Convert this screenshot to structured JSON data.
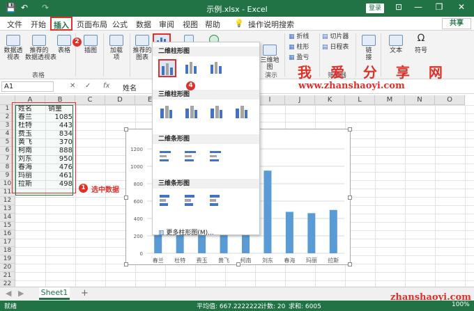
{
  "titlebar": {
    "title": "示例.xlsx  -  Excel",
    "login": "登录",
    "save": "💾",
    "undo": "↶",
    "redo": "↷",
    "minimize": "—",
    "restore": "❐",
    "close": "✕",
    "ribbon_toggle": "⊡"
  },
  "tabs": [
    "文件",
    "开始",
    "插入",
    "页面布局",
    "公式",
    "数据",
    "审阅",
    "视图",
    "帮助"
  ],
  "tell_me": "操作说明搜索",
  "share": "共享",
  "ribbon": {
    "pivot": "数据透\n视表",
    "rec_pivot": "推荐的\n数据透视表",
    "table": "表格",
    "group_table": "表格",
    "illustrations": "插图",
    "addins": "加载\n项",
    "rec_charts": "推荐的\n图表",
    "map3d": "三维地\n图",
    "group_demo": "演示",
    "line": "折线",
    "column": "柱形",
    "winloss": "盈亏",
    "slicer": "切片器",
    "timeline": "日程表",
    "filter_group": "筛选器",
    "link": "链\n接",
    "text": "文本",
    "symbol": "符号"
  },
  "callouts": [
    "1",
    "2",
    "3",
    "4"
  ],
  "watermark": "我 爱 分 享 网",
  "website": "www.zhanshaoyi.com",
  "formula": {
    "namebox": "A1",
    "cancel": "✕",
    "enter": "✓",
    "fx": "fx",
    "value": "姓名"
  },
  "columns": [
    "A",
    "B",
    "C",
    "D",
    "E",
    "F",
    "G",
    "H",
    "I",
    "J",
    "K",
    "L",
    "M",
    "N",
    "O"
  ],
  "rows": [
    "1",
    "2",
    "3",
    "4",
    "5",
    "6",
    "7",
    "8",
    "9",
    "10",
    "11",
    "12",
    "13",
    "14",
    "15",
    "16",
    "17",
    "18",
    "19",
    "20",
    "21",
    "22"
  ],
  "table": {
    "headers": [
      "姓名",
      "销量"
    ],
    "rows": [
      [
        "春兰",
        "1085"
      ],
      [
        "杜特",
        "443"
      ],
      [
        "费玉",
        "834"
      ],
      [
        "黄飞",
        "370"
      ],
      [
        "柯南",
        "888"
      ],
      [
        "刘东",
        "950"
      ],
      [
        "春海",
        "476"
      ],
      [
        "玛丽",
        "461"
      ],
      [
        "拉斯",
        "498"
      ]
    ]
  },
  "note": "选中数据",
  "dropdown": {
    "h1": "二维柱形图",
    "h2": "三维柱形图",
    "h3": "二维条形图",
    "h4": "三维条形图",
    "more": "更多柱形图(M)..."
  },
  "chart_data": {
    "type": "bar",
    "categories": [
      "春兰",
      "杜特",
      "费玉",
      "黄飞",
      "柯南",
      "刘东",
      "春海",
      "玛丽",
      "拉斯"
    ],
    "values": [
      1085,
      443,
      834,
      370,
      888,
      950,
      476,
      461,
      498
    ],
    "title": "",
    "xlabel": "",
    "ylabel": "",
    "ylim": [
      0,
      1200
    ],
    "yticks": [
      "0",
      "200",
      "400",
      "600",
      "800",
      "1000",
      "1200"
    ],
    "bar_color": "#5b9bd5",
    "grid": true
  },
  "sheet": {
    "name": "Sheet1",
    "add": "+"
  },
  "status": {
    "ready": "就绪",
    "average": "平均值: 667.2222222",
    "count": "计数: 20",
    "sum": "求和: 6005",
    "zoom": "100%"
  },
  "website2": "zhanshaoyi.com"
}
